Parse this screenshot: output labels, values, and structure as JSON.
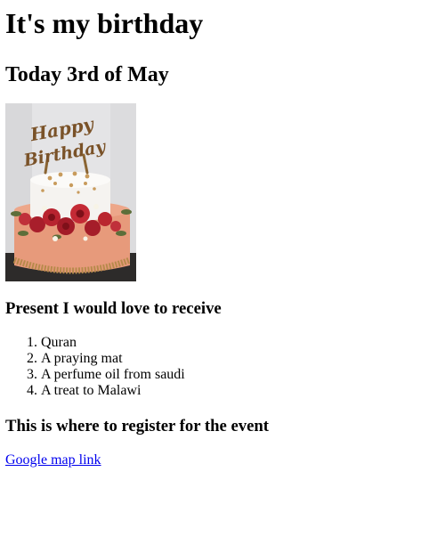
{
  "page": {
    "title": "It's my birthday",
    "date_heading": "Today 3rd of May"
  },
  "photo": {
    "cake_topper_text": "Happy Birthday",
    "colors": {
      "background": "#e6e6e8",
      "cake_white": "#f4f2ef",
      "cake_peach": "#e89b7c",
      "roses": "#b01f2e",
      "gold": "#b88a4a",
      "board": "#2b2b2b"
    }
  },
  "presents": {
    "heading": "Present I would love to receive",
    "items": [
      "Quran",
      "A praying mat",
      "A perfume oil from saudi",
      "A treat to Malawi"
    ]
  },
  "register": {
    "heading": "This is where to register for the event",
    "link_text": "Google map link"
  }
}
